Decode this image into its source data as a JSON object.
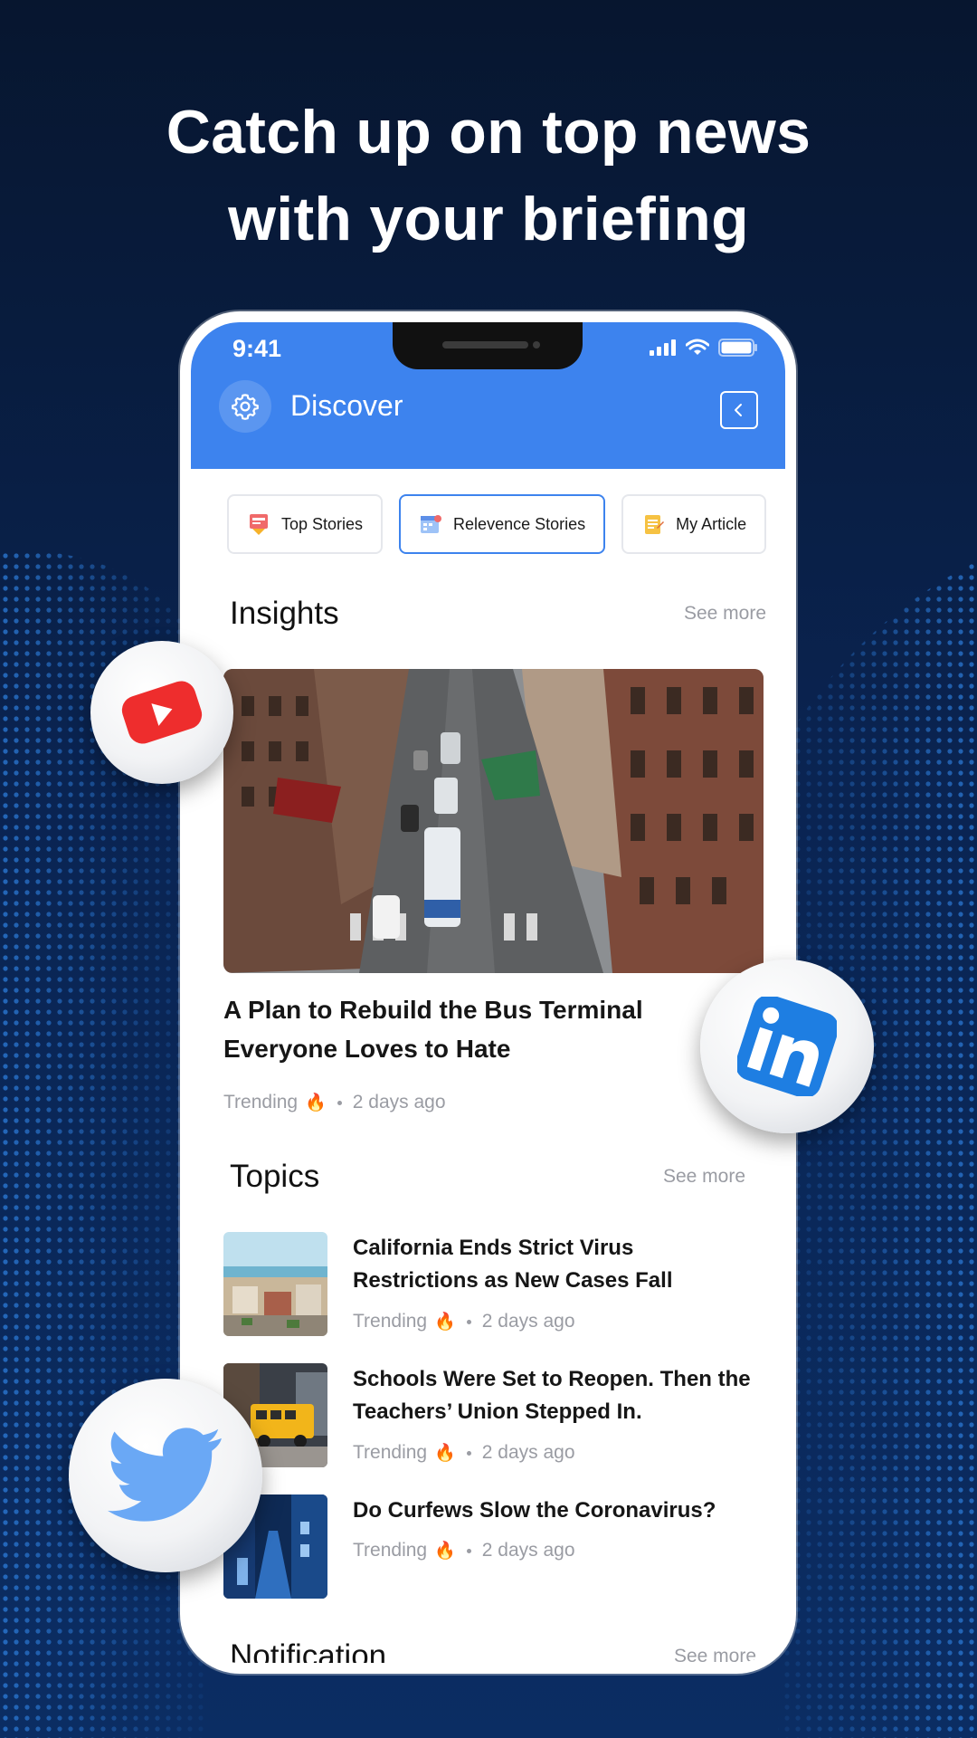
{
  "headline": {
    "line1": "Catch up on top news",
    "line2": "with your briefing"
  },
  "status_bar": {
    "time": "9:41",
    "icons": [
      "signal-icon",
      "wifi-icon",
      "battery-icon"
    ]
  },
  "app_bar": {
    "title": "Discover",
    "left_icon": "gear-icon",
    "right_icon": "back-chevron-icon"
  },
  "chips": [
    {
      "label": "Top Stories",
      "icon": "news-icon",
      "active": false
    },
    {
      "label": "Relevence Stories",
      "icon": "calendar-icon",
      "active": true
    },
    {
      "label": "My Article",
      "icon": "notepad-icon",
      "active": false
    }
  ],
  "insights": {
    "title": "Insights",
    "see_more": "See more",
    "article": {
      "title": "A Plan to Rebuild the Bus Terminal Everyone Loves to Hate",
      "tag": "Trending",
      "tag_icon": "fire-icon",
      "time": "2 days ago"
    }
  },
  "topics": {
    "title": "Topics",
    "see_more": "See more",
    "items": [
      {
        "title": "California Ends Strict Virus Restrictions as New Cases Fall",
        "tag": "Trending",
        "time": "2 days ago"
      },
      {
        "title": "Schools Were Set to Reopen. Then the Teachers’ Union Stepped In.",
        "tag": "Trending",
        "time": "2 days ago"
      },
      {
        "title": "Do Curfews Slow the Coronavirus?",
        "tag": "Trending",
        "time": "2 days ago"
      }
    ]
  },
  "notification": {
    "title": "Notification",
    "see_more": "See more"
  },
  "social_icons": [
    "youtube-icon",
    "linkedin-icon",
    "twitter-icon"
  ],
  "colors": {
    "accent": "#3d83ee",
    "background": "#0a2452",
    "muted_text": "#9a9ca3",
    "youtube": "#ee2d2d",
    "linkedin": "#1e7ee2",
    "twitter": "#6aa8f5"
  }
}
